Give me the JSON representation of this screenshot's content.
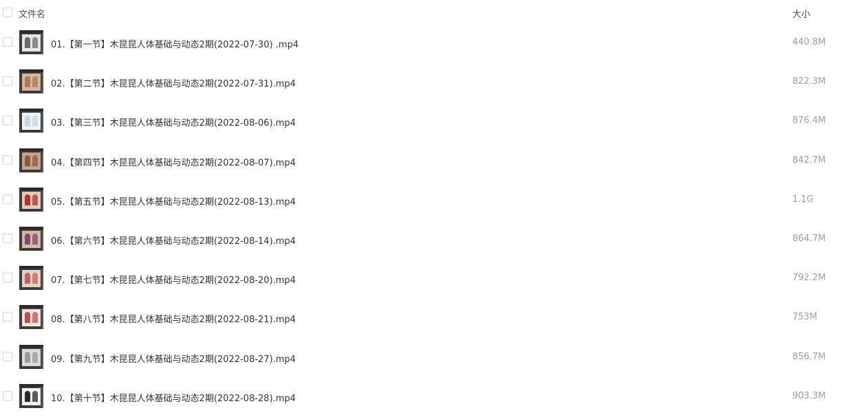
{
  "header": {
    "name_label": "文件名",
    "size_label": "大小"
  },
  "files": [
    {
      "name": "01.【第一节】木昆昆人体基础与动态2期(2022-07-30) .mp4",
      "size": "440.8M",
      "thumb_colors": [
        "#6b6b6b",
        "#e9e6e0"
      ]
    },
    {
      "name": "02.【第二节】木昆昆人体基础与动态2期(2022-07-31).mp4",
      "size": "822.3M",
      "thumb_colors": [
        "#b07a5a",
        "#d8b49a"
      ]
    },
    {
      "name": "03.【第三节】木昆昆人体基础与动态2期(2022-08-06).mp4",
      "size": "876.4M",
      "thumb_colors": [
        "#c9d6df",
        "#eef2f4"
      ]
    },
    {
      "name": "04.【第四节】木昆昆人体基础与动态2期(2022-08-07).mp4",
      "size": "842.7M",
      "thumb_colors": [
        "#8a5a44",
        "#caa088"
      ]
    },
    {
      "name": "05.【第五节】木昆昆人体基础与动态2期(2022-08-13).mp4",
      "size": "1.1G",
      "thumb_colors": [
        "#b8322e",
        "#e6c9b8"
      ]
    },
    {
      "name": "06.【第六节】木昆昆人体基础与动态2期(2022-08-14).mp4",
      "size": "864.7M",
      "thumb_colors": [
        "#7a4a7a",
        "#d9b6a0"
      ]
    },
    {
      "name": "07.【第七节】木昆昆人体基础与动态2期(2022-08-20).mp4",
      "size": "792.2M",
      "thumb_colors": [
        "#b86a5a",
        "#e8d0c4"
      ]
    },
    {
      "name": "08.【第八节】木昆昆人体基础与动态2期(2022-08-21).mp4",
      "size": "753M",
      "thumb_colors": [
        "#c0504a",
        "#f0e6de"
      ]
    },
    {
      "name": "09.【第九节】木昆昆人体基础与动态2期(2022-08-27).mp4",
      "size": "856.7M",
      "thumb_colors": [
        "#9a9a9a",
        "#dcdcdc"
      ]
    },
    {
      "name": "10.【第十节】木昆昆人体基础与动态2期(2022-08-28).mp4",
      "size": "903.3M",
      "thumb_colors": [
        "#2a2a2a",
        "#f2f2f2"
      ]
    }
  ]
}
